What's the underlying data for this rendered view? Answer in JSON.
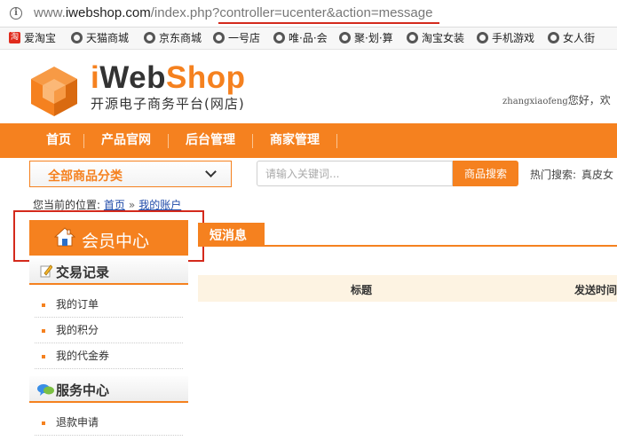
{
  "browser": {
    "url_prefix": "www.",
    "url_host": "iwebshop.com",
    "url_path": "/index.php?",
    "url_query": "controller=ucenter&action=message"
  },
  "bookmarks": [
    {
      "label": "爱淘宝",
      "icon": "taobao-icon"
    },
    {
      "label": "天猫商城",
      "icon": "globe-icon"
    },
    {
      "label": "京东商城",
      "icon": "globe-icon"
    },
    {
      "label": "一号店",
      "icon": "globe-icon"
    },
    {
      "label": "唯·品·会",
      "icon": "globe-icon"
    },
    {
      "label": "聚·划·算",
      "icon": "globe-icon"
    },
    {
      "label": "淘宝女装",
      "icon": "globe-icon"
    },
    {
      "label": "手机游戏",
      "icon": "globe-icon"
    },
    {
      "label": "女人街",
      "icon": "globe-icon"
    }
  ],
  "header": {
    "logo_i": "i",
    "logo_web": "Web",
    "logo_shop": "Shop",
    "slogan": "开源电子商务平台(网店)",
    "username": "zhangxiaofeng",
    "greeting": "您好，欢"
  },
  "nav": [
    "首页",
    "产品官网",
    "后台管理",
    "商家管理"
  ],
  "search": {
    "category_label": "全部商品分类",
    "placeholder": "请输入关键词...",
    "button_label": "商品搜索",
    "hot_label": "热门搜索:",
    "hot_keyword": "真皮女"
  },
  "breadcrumb": {
    "prefix": "您当前的位置:",
    "home": "首页",
    "sep": "»",
    "current": "我的账户"
  },
  "sidebar": {
    "title": "会员中心",
    "sections": [
      {
        "title": "交易记录",
        "items": [
          "我的订单",
          "我的积分",
          "我的代金券"
        ]
      },
      {
        "title": "服务中心",
        "items": [
          "退款申请"
        ]
      }
    ]
  },
  "content": {
    "tab_label": "短消息",
    "columns": [
      "标题",
      "发送时间"
    ]
  },
  "colors": {
    "accent": "#f5811f",
    "highlight": "#d42a1c",
    "link": "#1f4aa8"
  }
}
